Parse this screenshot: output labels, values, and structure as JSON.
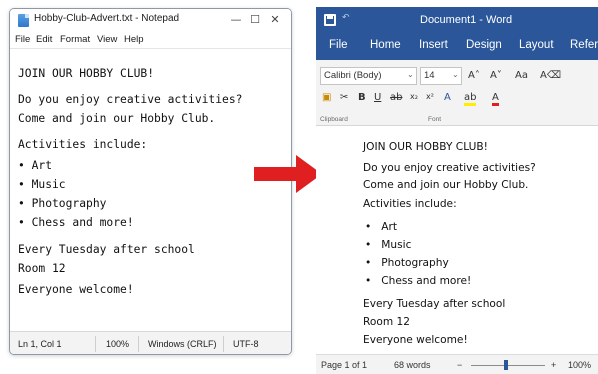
{
  "notepad": {
    "title": "Hobby-Club-Advert.txt - Notepad",
    "controls": {
      "minimize": "—",
      "maximize": "☐",
      "close": "✕"
    },
    "menu": [
      "File",
      "Edit",
      "Format",
      "View",
      "Help"
    ],
    "lines": [
      "JOIN OUR HOBBY CLUB!",
      "Do you enjoy creative activities?",
      "Come and join our Hobby Club.",
      "Activities include:",
      "• Art",
      "• Music",
      "• Photography",
      "• Chess and more!",
      "Every Tuesday after school",
      "Room 12",
      "Everyone welcome!"
    ],
    "status": {
      "position": "Ln 1, Col 1",
      "zoom": "100%",
      "line_ending": "Windows (CRLF)",
      "encoding": "UTF-8"
    }
  },
  "word": {
    "title": "Document1 - Word",
    "tabs": [
      "File",
      "Home",
      "Insert",
      "Design",
      "Layout",
      "Refer"
    ],
    "ribbon": {
      "font_name": "Calibri (Body)",
      "font_size": "14",
      "group_labels": [
        "Clipboard",
        "Font"
      ]
    },
    "document": {
      "title": "JOIN OUR HOBBY CLUB!",
      "para1": "Do you enjoy creative activities?",
      "para2": "Come and join our Hobby Club.",
      "list_heading": "Activities include:",
      "bullets": [
        "Art",
        "Music",
        "Photography",
        "Chess and more!"
      ],
      "para3": "Every Tuesday after school",
      "para4": "Room 12",
      "para5": "Everyone welcome!"
    },
    "status": {
      "page": "Page 1 of 1",
      "words": "68 words",
      "zoom_minus": "−",
      "zoom_plus": "+",
      "zoom": "100%"
    }
  },
  "colors": {
    "word_blue": "#2b579a",
    "arrow_red": "#e02020"
  },
  "icons": [
    "notepad-file-icon",
    "word-save-icon",
    "red-arrow"
  ]
}
